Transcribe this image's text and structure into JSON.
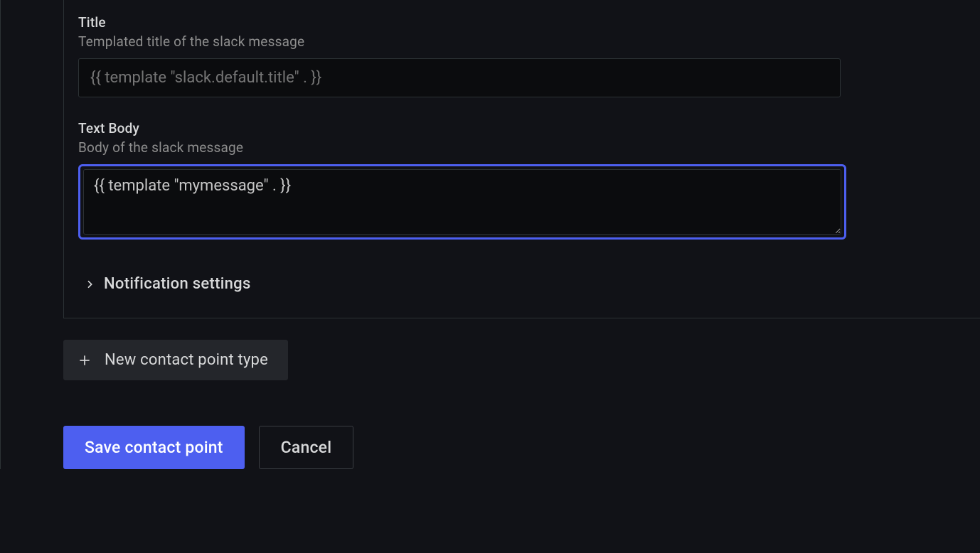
{
  "form": {
    "title": {
      "label": "Title",
      "description": "Templated title of the slack message",
      "placeholder": "{{ template \"slack.default.title\" . }}",
      "value": ""
    },
    "textBody": {
      "label": "Text Body",
      "description": "Body of the slack message",
      "value": "{{ template \"mymessage\" . }}"
    },
    "notificationSettings": {
      "label": "Notification settings"
    }
  },
  "buttons": {
    "newContactPointType": "New contact point type",
    "save": "Save contact point",
    "cancel": "Cancel"
  }
}
